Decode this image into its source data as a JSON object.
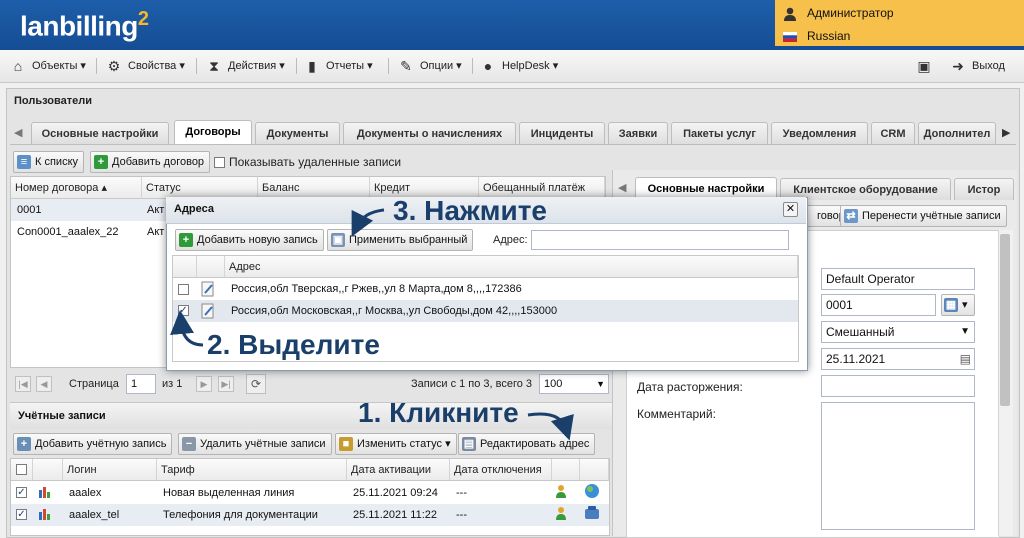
{
  "header": {
    "logo_text": "lanbilling",
    "logo_sup": "2",
    "user": "Администратор",
    "language": "Russian"
  },
  "menu": {
    "items": [
      {
        "label": "Объекты",
        "icon": "house-icon"
      },
      {
        "label": "Свойства",
        "icon": "gear-icon"
      },
      {
        "label": "Действия",
        "icon": "hourglass-icon"
      },
      {
        "label": "Отчеты",
        "icon": "bar-chart-icon"
      },
      {
        "label": "Опции",
        "icon": "wrench-icon"
      },
      {
        "label": "HelpDesk",
        "icon": "chat-icon"
      }
    ],
    "logout_label": "Выход"
  },
  "panel": {
    "title": "Пользователи",
    "tabs": [
      "Основные настройки",
      "Договоры",
      "Документы",
      "Документы о начислениях",
      "Инциденты",
      "Заявки",
      "Пакеты услуг",
      "Уведомления",
      "CRM",
      "Дополнител"
    ],
    "active_tab": "Договоры"
  },
  "contracts": {
    "to_list": "К списку",
    "add_contract": "Добавить договор",
    "show_deleted": "Показывать удаленные записи",
    "columns": [
      "Номер договора",
      "Статус",
      "Баланс",
      "Кредит",
      "Обещанный платёж"
    ],
    "rows": [
      {
        "number": "0001",
        "status": "Акт"
      },
      {
        "number": "Con0001_aaalex_22",
        "status": "Акт"
      }
    ],
    "pager": {
      "page_label": "Страница",
      "page": "1",
      "of": "из 1",
      "records": "Записи с 1 по 3, всего 3",
      "page_size": "100"
    }
  },
  "accounts": {
    "title": "Учётные записи",
    "add": "Добавить учётную запись",
    "delete": "Удалить учётные записи",
    "change_status": "Изменить статус",
    "edit_address": "Редактировать адрес",
    "columns": [
      "Логин",
      "Тариф",
      "Дата активации",
      "Дата отключения"
    ],
    "rows": [
      {
        "login": "aaalex",
        "tariff": "Новая выделенная линия",
        "activated": "25.11.2021 09:24",
        "disconnected": "---"
      },
      {
        "login": "aaalex_tel",
        "tariff": "Телефония для документации",
        "activated": "25.11.2021 11:22",
        "disconnected": "---"
      }
    ]
  },
  "right_panel": {
    "tabs": [
      "Основные настройки",
      "Клиентское оборудование",
      "Истор"
    ],
    "btn_partial": "говор",
    "btn_transfer": "Перенести учётные записи",
    "operator": "Default Operator",
    "contract_no": "0001",
    "type": "Смешанный",
    "date": "25.11.2021",
    "termination_label": "Дата расторжения:",
    "comment_label": "Комментарий:"
  },
  "dialog": {
    "title": "Адреса",
    "add_record": "Добавить новую запись",
    "apply_selected": "Применить выбранный",
    "address_label": "Адрес:",
    "column": "Адрес",
    "rows": [
      {
        "address": "Россия,обл Тверская,,г Ржев,,ул 8 Марта,дом 8,,,,172386",
        "checked": false
      },
      {
        "address": "Россия,обл Московская,,г Москва,,ул Свободы,дом 42,,,,153000",
        "checked": true
      }
    ]
  },
  "annotations": {
    "step1": "1. Кликните",
    "step2": "2. Выделите",
    "step3": "3. Нажмите"
  },
  "colors": {
    "header_blue": "#1e5eaa",
    "user_box": "#f6c04a",
    "annotation": "#1a3f6a"
  }
}
